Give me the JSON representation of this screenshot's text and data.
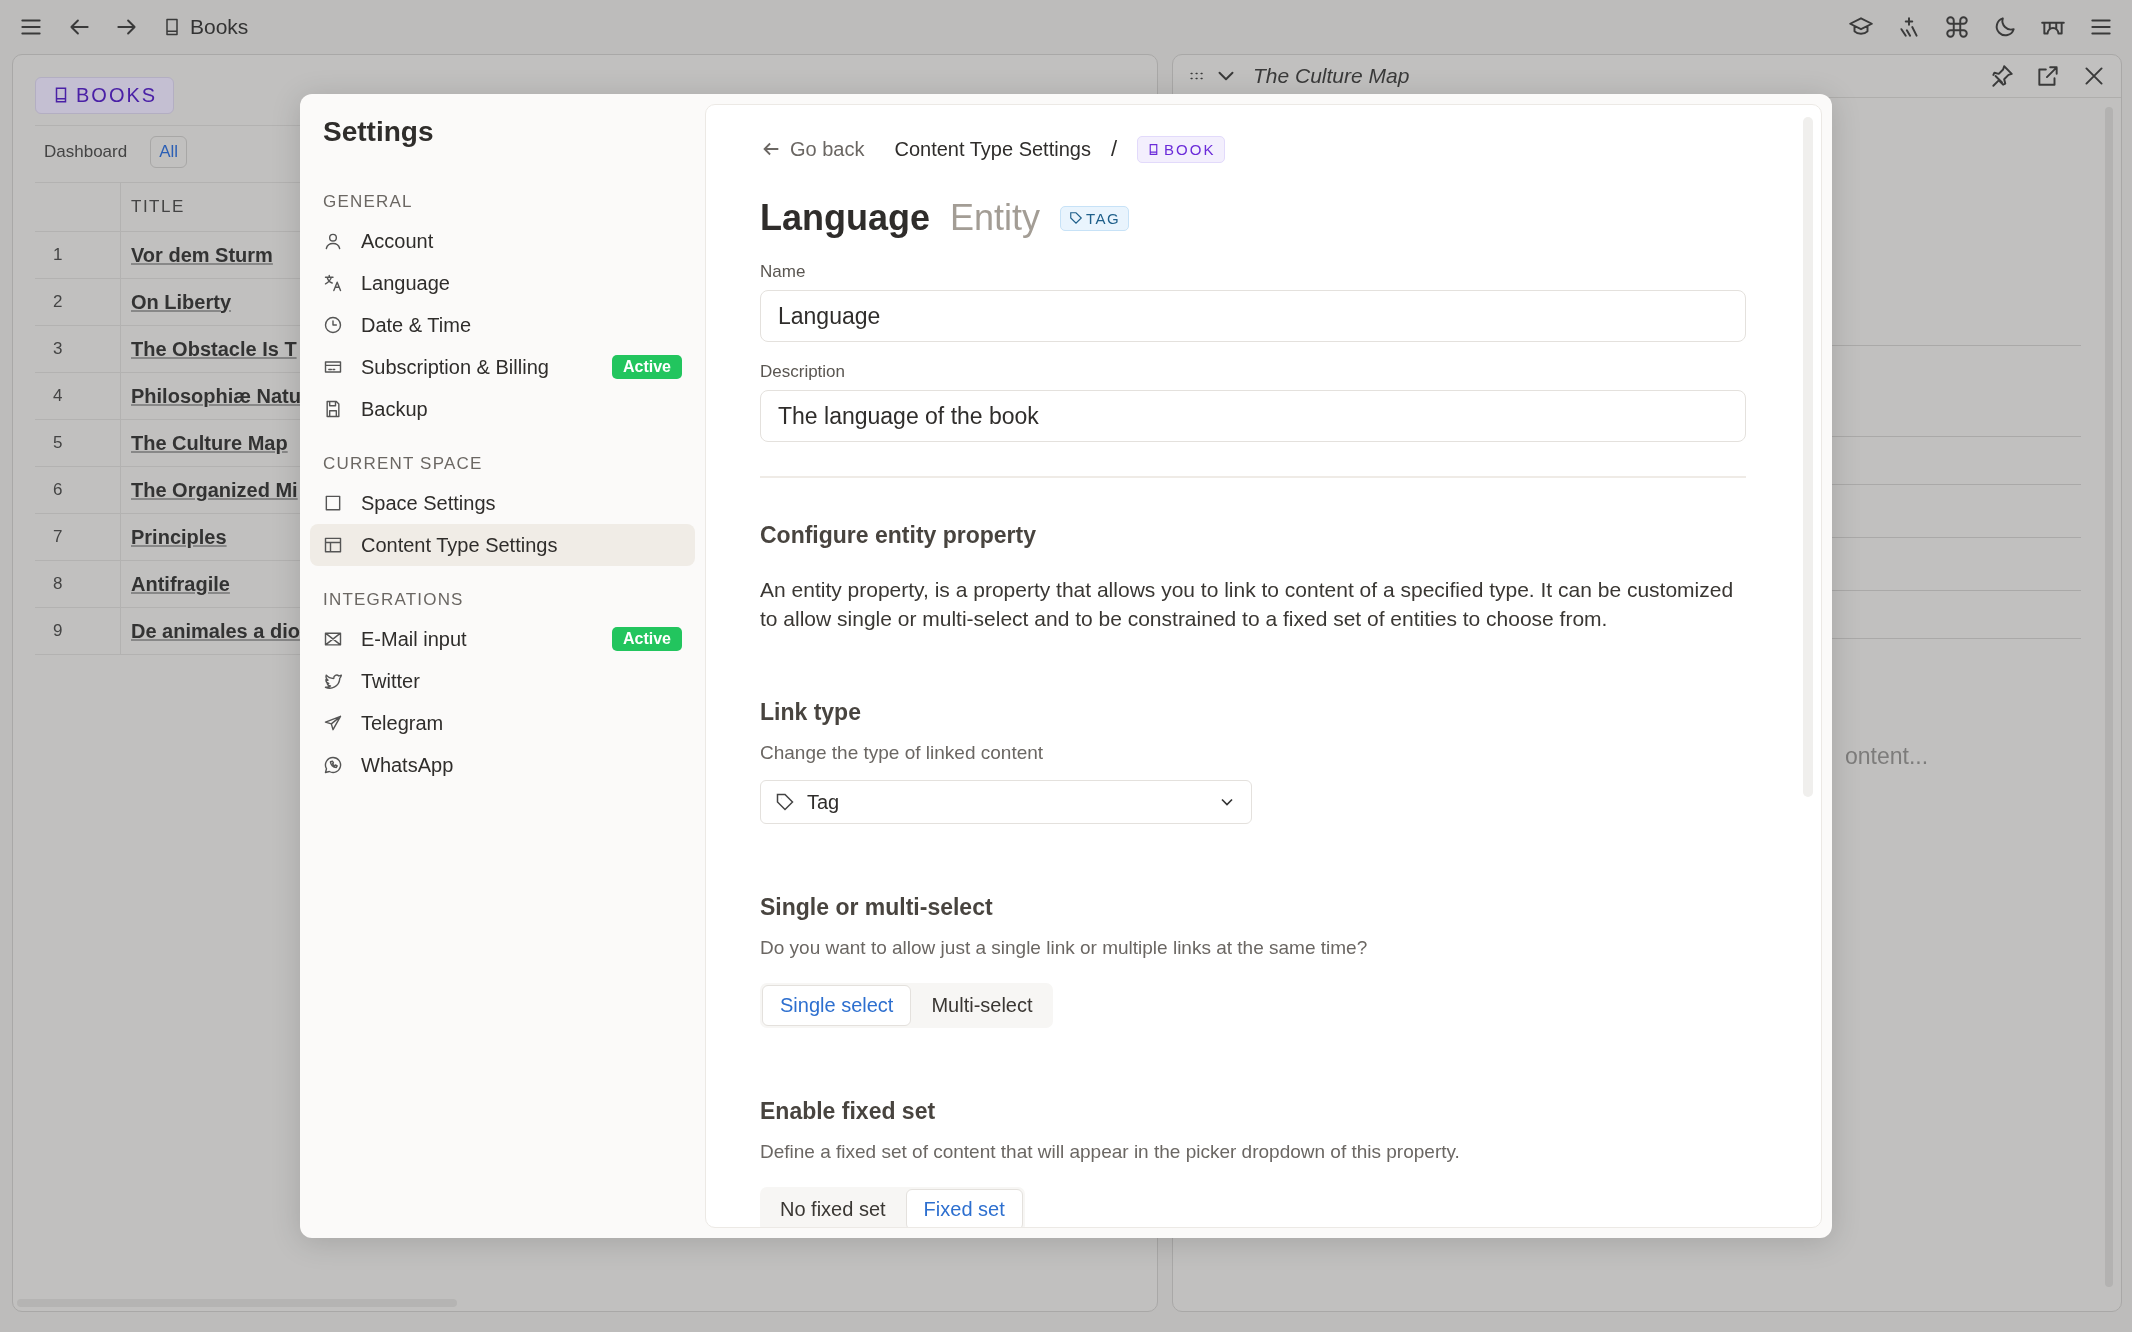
{
  "topbar": {
    "title": "Books"
  },
  "left_panel": {
    "badge": "BOOKS",
    "views": [
      {
        "label": "Dashboard",
        "selected": false
      },
      {
        "label": "All",
        "selected": true
      }
    ],
    "table": {
      "columns": [
        "TITLE"
      ],
      "rows": [
        {
          "number": "1",
          "title": "Vor dem Sturm"
        },
        {
          "number": "2",
          "title": "On Liberty"
        },
        {
          "number": "3",
          "title": "The Obstacle Is T"
        },
        {
          "number": "4",
          "title": "Philosophiæ Natu"
        },
        {
          "number": "5",
          "title": "The Culture Map"
        },
        {
          "number": "6",
          "title": "The Organized Mi"
        },
        {
          "number": "7",
          "title": "Principles"
        },
        {
          "number": "8",
          "title": "Antifragile"
        },
        {
          "number": "9",
          "title": "De animales a dio"
        }
      ]
    }
  },
  "right_panel": {
    "title": "The Culture Map",
    "placeholder": "ontent..."
  },
  "settings": {
    "title": "Settings",
    "sections": [
      {
        "heading": "GENERAL",
        "items": [
          {
            "label": "Account",
            "selected": false
          },
          {
            "label": "Language",
            "selected": false
          },
          {
            "label": "Date & Time",
            "selected": false
          },
          {
            "label": "Subscription & Billing",
            "selected": false,
            "badge": "Active"
          },
          {
            "label": "Backup",
            "selected": false
          }
        ]
      },
      {
        "heading": "CURRENT SPACE",
        "items": [
          {
            "label": "Space Settings",
            "selected": false
          },
          {
            "label": "Content Type Settings",
            "selected": true
          }
        ]
      },
      {
        "heading": "INTEGRATIONS",
        "items": [
          {
            "label": "E-Mail input",
            "selected": false,
            "badge": "Active"
          },
          {
            "label": "Twitter",
            "selected": false
          },
          {
            "label": "Telegram",
            "selected": false
          },
          {
            "label": "WhatsApp",
            "selected": false
          }
        ]
      }
    ]
  },
  "detail": {
    "back": "Go back",
    "breadcrumb": "Content Type Settings",
    "separator": "/",
    "type_badge": "BOOK",
    "title": "Language",
    "subtitle": "Entity",
    "kind_badge": "TAG",
    "fields": [
      {
        "label": "Name",
        "value": "Language"
      },
      {
        "label": "Description",
        "value": "The language of the book"
      }
    ],
    "section_title": "Configure entity property",
    "section_text": "An entity property, is a property that allows you to link to content of a specified type. It can be customized to allow single or multi-select and to be constrained to a fixed set of entities to choose from.",
    "groups": [
      {
        "kind": "dropdown",
        "title": "Link type",
        "hint": "Change the type of linked content",
        "value": "Tag"
      },
      {
        "kind": "segmented",
        "title": "Single or multi-select",
        "hint": "Do you want to allow just a single link or multiple links at the same time?",
        "options": [
          {
            "label": "Single select",
            "selected": true
          },
          {
            "label": "Multi-select",
            "selected": false
          }
        ]
      },
      {
        "kind": "segmented",
        "title": "Enable fixed set",
        "hint": "Define a fixed set of content that will appear in the picker dropdown of this property.",
        "options": [
          {
            "label": "No fixed set",
            "selected": false
          },
          {
            "label": "Fixed set",
            "selected": true
          }
        ]
      }
    ]
  }
}
